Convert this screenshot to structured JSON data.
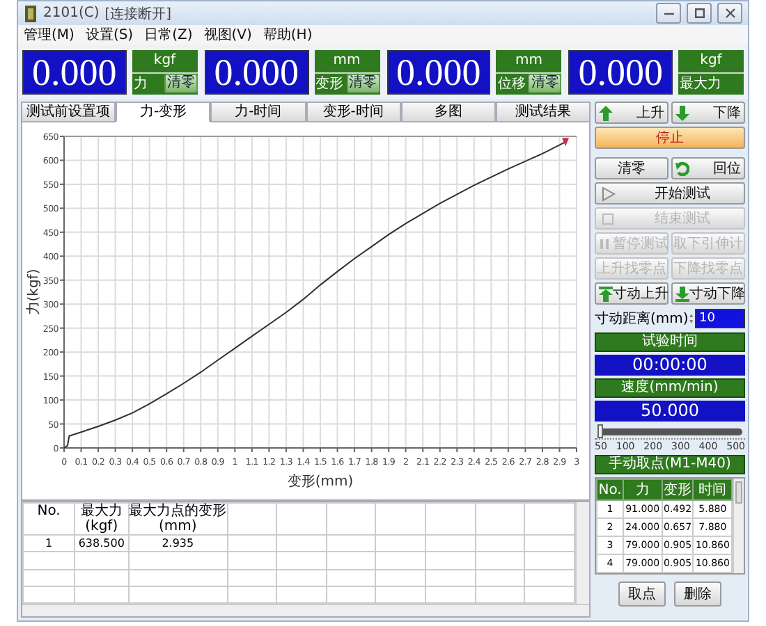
{
  "window": {
    "title": "2101(C)",
    "status": "[连接断开]"
  },
  "menu": [
    "管理(M)",
    "设置(S)",
    "日常(Z)",
    "视图(V)",
    "帮助(H)"
  ],
  "displays": [
    {
      "value": "0.000",
      "unit": "kgf",
      "label": "力",
      "zero_button": "清零"
    },
    {
      "value": "0.000",
      "unit": "mm",
      "label": "变形",
      "zero_button": "清零"
    },
    {
      "value": "0.000",
      "unit": "mm",
      "label": "位移",
      "zero_button": "清零"
    },
    {
      "value": "0.000",
      "unit": "kgf",
      "label": "最大力"
    }
  ],
  "tabs": [
    {
      "label": "测试前设置项",
      "selected": false
    },
    {
      "label": "力-变形",
      "selected": true
    },
    {
      "label": "力-时间",
      "selected": false
    },
    {
      "label": "变形-时间",
      "selected": false
    },
    {
      "label": "多图",
      "selected": false
    },
    {
      "label": "测试结果",
      "selected": false
    }
  ],
  "chart_data": {
    "type": "line",
    "xlabel": "变形(mm)",
    "ylabel": "力(kgf)",
    "x": [
      0,
      0.02,
      0.03,
      0.1,
      0.2,
      0.3,
      0.4,
      0.5,
      0.6,
      0.7,
      0.8,
      0.9,
      1.0,
      1.1,
      1.2,
      1.3,
      1.4,
      1.5,
      1.6,
      1.7,
      1.8,
      1.9,
      2.0,
      2.2,
      2.4,
      2.6,
      2.8,
      2.935
    ],
    "series": [
      {
        "color": "#303030",
        "values": [
          0,
          5,
          25,
          33,
          45,
          58,
          73,
          92,
          113,
          135,
          158,
          183,
          208,
          233,
          258,
          283,
          310,
          340,
          368,
          395,
          420,
          445,
          468,
          510,
          548,
          582,
          614,
          638
        ]
      }
    ],
    "grid": true,
    "xlim": [
      0,
      3
    ],
    "ylim": [
      0,
      650
    ],
    "xticks": [
      0,
      0.1,
      0.2,
      0.3,
      0.4,
      0.5,
      0.6,
      0.7,
      0.8,
      0.9,
      1,
      1.1,
      1.2,
      1.3,
      1.4,
      1.5,
      1.6,
      1.7,
      1.8,
      1.9,
      2,
      2.1,
      2.2,
      2.3,
      2.4,
      2.5,
      2.6,
      2.7,
      2.8,
      2.9,
      3
    ],
    "yticks": [
      0,
      50,
      100,
      150,
      200,
      250,
      300,
      350,
      400,
      450,
      500,
      550,
      600,
      650
    ]
  },
  "results_table": {
    "columns": [
      {
        "label": "No."
      },
      {
        "label": "最大力",
        "unit": "(kgf)"
      },
      {
        "label": "最大力点的变形",
        "unit": "(mm)"
      }
    ],
    "rows": [
      [
        "1",
        "638.500",
        "2.935"
      ]
    ]
  },
  "button_rows": [
    [
      {
        "label": "上升",
        "kind": "up",
        "disabled": false
      },
      {
        "label": "下降",
        "kind": "down",
        "disabled": false
      }
    ],
    [
      {
        "label": "停止",
        "kind": "stop",
        "disabled": false
      }
    ],
    [
      {
        "label": "清零",
        "kind": "plain",
        "disabled": false
      },
      {
        "label": "回位",
        "kind": "rotate",
        "disabled": false
      }
    ],
    [
      {
        "label": "开始测试",
        "kind": "play",
        "disabled": false
      }
    ],
    [
      {
        "label": "结束测试",
        "kind": "square",
        "disabled": true
      }
    ],
    [
      {
        "label": "暂停测试",
        "kind": "pause",
        "disabled": true
      },
      {
        "label": "取下引伸计",
        "kind": "plain",
        "disabled": true
      }
    ],
    [
      {
        "label": "上升找零点",
        "kind": "plain",
        "disabled": true
      },
      {
        "label": "下降找零点",
        "kind": "plain",
        "disabled": true
      }
    ],
    [
      {
        "label": "寸动上升",
        "kind": "jog-up",
        "disabled": false
      },
      {
        "label": "寸动下降",
        "kind": "jog-down",
        "disabled": false
      }
    ]
  ],
  "jog_distance": {
    "label": "寸动距离(mm)",
    "value": "10"
  },
  "test_time": {
    "label": "试验时间",
    "value": "00:00:00"
  },
  "speed": {
    "label": "速度(mm/min)",
    "value": "50.000",
    "level": 0,
    "scale": [
      "50",
      "100",
      "200",
      "300",
      "400",
      "500"
    ]
  },
  "manual_points": {
    "title": "手动取点(M1-M40)",
    "columns": [
      "No.",
      "力",
      "变形",
      "时间"
    ],
    "rows": [
      [
        "1",
        "91.000",
        "0.492",
        "5.880"
      ],
      [
        "2",
        "24.000",
        "0.657",
        "7.880"
      ],
      [
        "3",
        "79.000",
        "0.905",
        "10.860"
      ],
      [
        "4",
        "79.000",
        "0.905",
        "10.860"
      ]
    ],
    "buttons": [
      "取点",
      "删除"
    ]
  }
}
